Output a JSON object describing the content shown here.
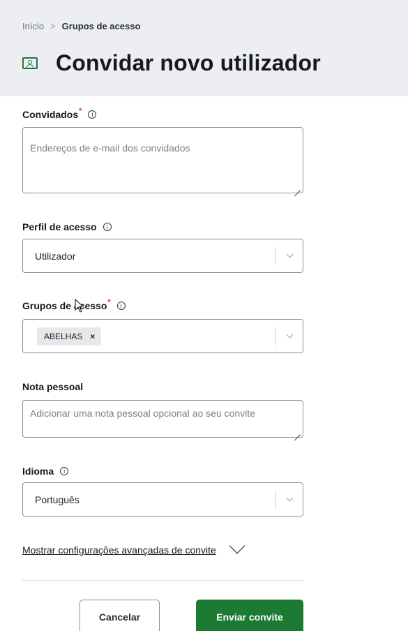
{
  "breadcrumb": {
    "home": "Início",
    "separator": ">",
    "current": "Grupos de acesso"
  },
  "page": {
    "title": "Convidar novo utilizador",
    "icon": "contact-card-icon"
  },
  "invitees": {
    "label": "Convidados",
    "required_mark": "*",
    "info": "i",
    "placeholder": "Endereços de e-mail dos convidados"
  },
  "access_profile": {
    "label": "Perfil de acesso",
    "info": "i",
    "value": "Utilizador"
  },
  "access_groups": {
    "label": "Grupos de acesso",
    "required_mark": "*",
    "info": "i",
    "tags": [
      {
        "label": "ABELHAS",
        "remove": "×"
      }
    ]
  },
  "personal_note": {
    "label": "Nota pessoal",
    "placeholder": "Adicionar uma nota pessoal opcional ao seu convite"
  },
  "language": {
    "label": "Idioma",
    "info": "i",
    "value": "Português"
  },
  "advanced": {
    "link_label": "Mostrar configurações avançadas de convite"
  },
  "actions": {
    "cancel_label": "Cancelar",
    "send_label": "Enviar convite"
  },
  "colors": {
    "primary": "#1d7a32",
    "header_bg": "#eceef3",
    "required": "#d0312d"
  }
}
